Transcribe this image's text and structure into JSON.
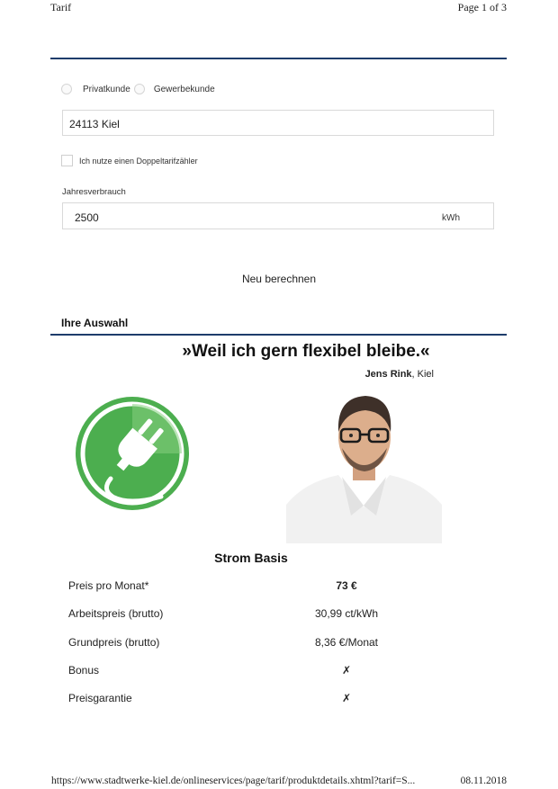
{
  "print_header": {
    "title": "Tarif",
    "page": "Page 1 of 3"
  },
  "customer_type": {
    "options": [
      "Privatkunde",
      "Gewerbekunde"
    ]
  },
  "location": {
    "value": "24113 Kiel"
  },
  "double_tariff": {
    "label": "Ich nutze einen Doppeltarifzähler",
    "checked": false
  },
  "usage": {
    "label": "Jahresverbrauch",
    "value": "2500",
    "unit": "kWh"
  },
  "recalculate_label": "Neu berechnen",
  "selection": {
    "title": "Ihre Auswahl",
    "quote": "»Weil ich gern flexibel bleibe.«",
    "person_name": "Jens Rink",
    "person_city": ", Kiel",
    "product_name": "Strom Basis",
    "icon": "plug-icon",
    "accent_color": "#5cb85c",
    "rows": [
      {
        "label": "Preis pro Monat*",
        "value": "73 €"
      },
      {
        "label": "Arbeitspreis (brutto)",
        "value": "30,99 ct/kWh"
      },
      {
        "label": "Grundpreis (brutto)",
        "value": "8,36 €/Monat"
      },
      {
        "label": "Bonus",
        "value": "✗"
      },
      {
        "label": "Preisgarantie",
        "value": "✗"
      }
    ]
  },
  "print_footer": {
    "url": "https://www.stadtwerke-kiel.de/onlineservices/page/tarif/produktdetails.xhtml?tarif=S...",
    "date": "08.11.2018"
  }
}
